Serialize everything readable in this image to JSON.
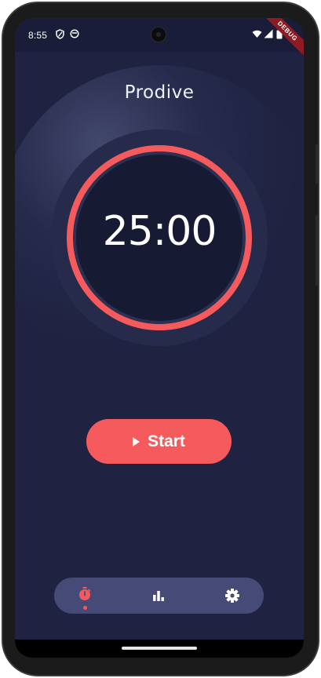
{
  "status_bar": {
    "time": "8:55",
    "left_icons": [
      "shield-icon",
      "app-notification-icon"
    ],
    "right_icons": [
      "wifi-icon",
      "signal-icon",
      "battery-icon"
    ]
  },
  "debug_banner": {
    "label": "DEBUG"
  },
  "app": {
    "title": "Prodive"
  },
  "timer": {
    "display": "25:00",
    "ring_color": "#f55a5c"
  },
  "start_button": {
    "label": "Start",
    "icon": "play-icon",
    "color": "#f55a5c"
  },
  "bottom_nav": {
    "items": [
      {
        "id": "timer",
        "icon": "stopwatch-icon",
        "active": true
      },
      {
        "id": "stats",
        "icon": "bar-chart-icon",
        "active": false
      },
      {
        "id": "settings",
        "icon": "gear-icon",
        "active": false
      }
    ],
    "active_color": "#f55a5c",
    "background": "#464a76"
  },
  "colors": {
    "background": "#1f2240",
    "accent": "#f55a5c"
  }
}
